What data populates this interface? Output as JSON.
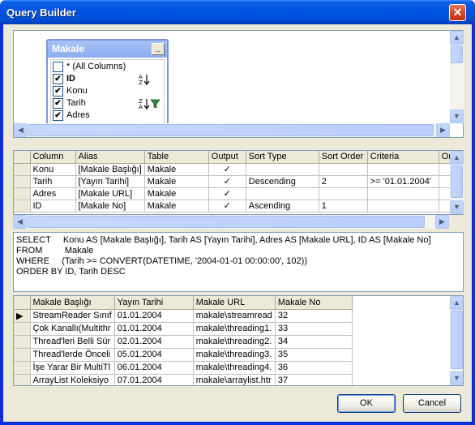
{
  "window": {
    "title": "Query Builder",
    "close_glyph": "✕"
  },
  "diagram": {
    "table_title": "Makale",
    "minimize_glyph": "_",
    "columns": [
      {
        "label": "* (All Columns)",
        "checked": false
      },
      {
        "label": "ID",
        "checked": true,
        "bold": true,
        "icon": "sort-ascending-icon"
      },
      {
        "label": "Konu",
        "checked": true
      },
      {
        "label": "Tarih",
        "checked": true,
        "icon": "sort-descending-filter-icon"
      },
      {
        "label": "Adres",
        "checked": true
      }
    ]
  },
  "grid": {
    "headers": [
      "Column",
      "Alias",
      "Table",
      "Output",
      "Sort Type",
      "Sort Order",
      "Criteria",
      "Or..."
    ],
    "rows": [
      [
        "Konu",
        "[Makale Başlığı]",
        "Makale",
        "✓",
        "",
        "",
        "",
        ""
      ],
      [
        "Tarih",
        "[Yayın Tarihi]",
        "Makale",
        "✓",
        "Descending",
        "2",
        ">= '01.01.2004'",
        ""
      ],
      [
        "Adres",
        "[Makale URL]",
        "Makale",
        "✓",
        "",
        "",
        "",
        ""
      ],
      [
        "ID",
        "[Makale No]",
        "Makale",
        "✓",
        "Ascending",
        "1",
        "",
        ""
      ]
    ]
  },
  "sql": {
    "lines": [
      "SELECT     Konu AS [Makale Başlığı], Tarih AS [Yayın Tarihi], Adres AS [Makale URL], ID AS [Makale No]",
      "FROM         Makale",
      "WHERE     (Tarih >= CONVERT(DATETIME, '2004-01-01 00:00:00', 102))",
      "ORDER BY ID, Tarih DESC"
    ]
  },
  "results": {
    "headers": [
      "Makale Başlığı",
      "Yayın Tarihi",
      "Makale URL",
      "Makale No"
    ],
    "rows": [
      [
        "StreamReader Sınıf",
        "01.01.2004",
        "makale\\streamread",
        "32"
      ],
      [
        "Çok Kanallı(Multithr",
        "01.01.2004",
        "makale\\threading1.",
        "33"
      ],
      [
        "Thread'leri Belli Sür",
        "02.01.2004",
        "makale\\threading2.",
        "34"
      ],
      [
        "Thread'lerde Önceli",
        "05.01.2004",
        "makale\\threading3.",
        "35"
      ],
      [
        "İşe Yarar Bir MultiTl",
        "06.01.2004",
        "makale\\threading4.",
        "36"
      ],
      [
        "ArrayList Koleksiyo",
        "07.01.2004",
        "makale\\arraylist.htr",
        "37"
      ]
    ],
    "current_row_glyph": "▶"
  },
  "buttons": {
    "ok": "OK",
    "cancel": "Cancel"
  },
  "scroll_glyphs": {
    "up": "▲",
    "down": "▼",
    "left": "◀",
    "right": "▶"
  },
  "colors": {
    "titlebar": "#0054e3",
    "client": "#ece9d8",
    "pane_border": "#7f9db9"
  }
}
